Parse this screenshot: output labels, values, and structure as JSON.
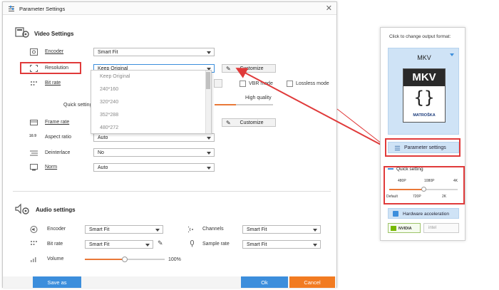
{
  "dialog": {
    "title": "Parameter Settings",
    "close": "✕"
  },
  "video": {
    "section_title": "Video Settings",
    "encoder": {
      "label": "Encoder",
      "value": "Smart Fit"
    },
    "resolution": {
      "label": "Resolution",
      "value": "Keep Original",
      "customize": "Customize"
    },
    "bitrate": {
      "label": "Bit rate"
    },
    "dropdown_options": [
      "Keep Original",
      "240*160",
      "320*240",
      "352*288",
      "480*272"
    ],
    "vbr_mode_label": "VBR mode",
    "lossless_mode_label": "Lossless mode",
    "quick_setting_label": "Quick setting",
    "high_quality_label": "High quality",
    "frame_rate": {
      "label": "Frame rate",
      "customize": "Customize"
    },
    "aspect_ratio": {
      "label": "Aspect ratio",
      "value": "Auto"
    },
    "deinterlace": {
      "label": "Deinterlace",
      "value": "No"
    },
    "norm": {
      "label": "Norm",
      "value": "Auto"
    }
  },
  "audio": {
    "section_title": "Audio settings",
    "encoder": {
      "label": "Encoder",
      "value": "Smart Fit"
    },
    "channels": {
      "label": "Channels",
      "value": "Smart Fit"
    },
    "bitrate": {
      "label": "Bit rate",
      "value": "Smart Fit"
    },
    "sample_rate": {
      "label": "Sample rate",
      "value": "Smart Fit"
    },
    "volume": {
      "label": "Volume",
      "value": "100%",
      "level": 0.5
    }
  },
  "footer": {
    "save_as": "Save as",
    "ok": "Ok",
    "cancel": "Cancel"
  },
  "panel": {
    "header": "Click to change output format:",
    "format_name": "MKV",
    "logo_text": "MKV",
    "logo_sub": "MATROŠKA",
    "parameter_settings": "Parameter settings",
    "quick_setting": "Quick setting",
    "top_ticks": [
      "480P",
      "1080P",
      "4K"
    ],
    "bottom_ticks": [
      "Default",
      "720P",
      "2K"
    ],
    "quick_level": 0.5,
    "hardware_acceleration": "Hardware acceleration",
    "nvidia": "NVIDIA",
    "intel": "intel"
  },
  "colors": {
    "accent_blue": "#3c8edc",
    "cancel_orange": "#f27b21",
    "highlight_red": "#e03a3a"
  }
}
